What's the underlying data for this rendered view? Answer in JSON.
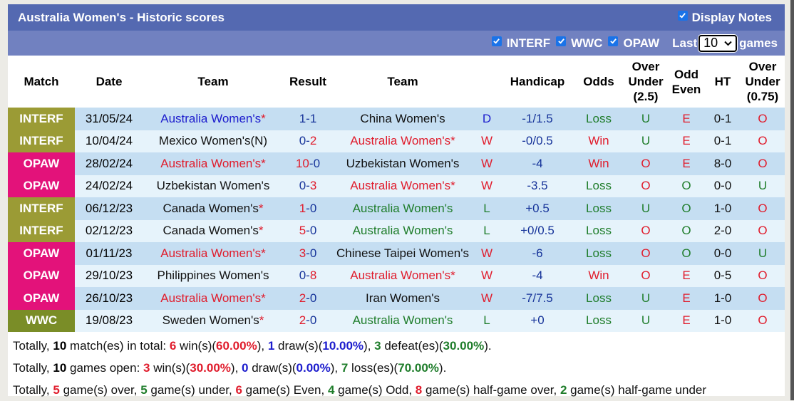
{
  "header": {
    "title": "Australia Women's - Historic scores",
    "display_notes_label": "Display Notes",
    "display_notes_checked": true
  },
  "filters": {
    "items": [
      {
        "label": "INTERF",
        "checked": true
      },
      {
        "label": "WWC",
        "checked": true
      },
      {
        "label": "OPAW",
        "checked": true
      }
    ],
    "last_label": "Last",
    "games_count": "10",
    "games_label": "games"
  },
  "columns": {
    "match": "Match",
    "date": "Date",
    "home_team": "Team",
    "result": "Result",
    "away_team": "Team",
    "handicap": "Handicap",
    "odds": "Odds",
    "over_under_line1": "Over",
    "over_under_line2": "Under",
    "over_under_line3": "(2.5)",
    "odd_even_line1": "Odd",
    "odd_even_line2": "Even",
    "ht": "HT",
    "ht_over_under_line1": "Over",
    "ht_over_under_line2": "Under",
    "ht_over_under_line3": "(0.75)"
  },
  "colors": {
    "INTERF": "#9b9b35",
    "WWC": "#7a8d27",
    "OPAW": "#e3127a",
    "header_bar": "#5469b1",
    "filter_bar": "#7181c0"
  },
  "rows": [
    {
      "league": "INTERF",
      "date": "31/05/24",
      "home": "Australia Women's",
      "home_star": "*",
      "home_color": "blue",
      "score_home": "1",
      "score_away": "1",
      "score_home_color": "navy",
      "score_away_color": "navy",
      "away": "China Women's",
      "away_star": "",
      "away_color": "dark",
      "outcome": "D",
      "outcome_color": "blue",
      "handicap": "-1/1.5",
      "odds": "Loss",
      "odds_color": "green",
      "ou": "U",
      "ou_color": "green",
      "oe": "E",
      "oe_color": "red",
      "ht": "0-1",
      "htou": "O",
      "htou_color": "red"
    },
    {
      "league": "INTERF",
      "date": "10/04/24",
      "home": "Mexico Women's(N)",
      "home_star": "",
      "home_color": "dark",
      "score_home": "0",
      "score_away": "2",
      "score_home_color": "navy",
      "score_away_color": "red",
      "away": "Australia Women's",
      "away_star": "*",
      "away_color": "red",
      "outcome": "W",
      "outcome_color": "red",
      "handicap": "-0/0.5",
      "odds": "Win",
      "odds_color": "red",
      "ou": "U",
      "ou_color": "green",
      "oe": "E",
      "oe_color": "red",
      "ht": "0-1",
      "htou": "O",
      "htou_color": "red"
    },
    {
      "league": "OPAW",
      "date": "28/02/24",
      "home": "Australia Women's",
      "home_star": "*",
      "home_color": "red",
      "score_home": "10",
      "score_away": "0",
      "score_home_color": "red",
      "score_away_color": "navy",
      "away": "Uzbekistan Women's",
      "away_star": "",
      "away_color": "dark",
      "outcome": "W",
      "outcome_color": "red",
      "handicap": "-4",
      "odds": "Win",
      "odds_color": "red",
      "ou": "O",
      "ou_color": "red",
      "oe": "E",
      "oe_color": "red",
      "ht": "8-0",
      "htou": "O",
      "htou_color": "red"
    },
    {
      "league": "OPAW",
      "date": "24/02/24",
      "home": "Uzbekistan Women's",
      "home_star": "",
      "home_color": "dark",
      "score_home": "0",
      "score_away": "3",
      "score_home_color": "navy",
      "score_away_color": "red",
      "away": "Australia Women's",
      "away_star": "*",
      "away_color": "red",
      "outcome": "W",
      "outcome_color": "red",
      "handicap": "-3.5",
      "odds": "Loss",
      "odds_color": "green",
      "ou": "O",
      "ou_color": "red",
      "oe": "O",
      "oe_color": "green",
      "ht": "0-0",
      "htou": "U",
      "htou_color": "green"
    },
    {
      "league": "INTERF",
      "date": "06/12/23",
      "home": "Canada Women's",
      "home_star": "*",
      "home_color": "dark",
      "score_home": "1",
      "score_away": "0",
      "score_home_color": "red",
      "score_away_color": "navy",
      "away": "Australia Women's",
      "away_star": "",
      "away_color": "green",
      "outcome": "L",
      "outcome_color": "green",
      "handicap": "+0.5",
      "odds": "Loss",
      "odds_color": "green",
      "ou": "U",
      "ou_color": "green",
      "oe": "O",
      "oe_color": "green",
      "ht": "1-0",
      "htou": "O",
      "htou_color": "red"
    },
    {
      "league": "INTERF",
      "date": "02/12/23",
      "home": "Canada Women's",
      "home_star": "*",
      "home_color": "dark",
      "score_home": "5",
      "score_away": "0",
      "score_home_color": "red",
      "score_away_color": "navy",
      "away": "Australia Women's",
      "away_star": "",
      "away_color": "green",
      "outcome": "L",
      "outcome_color": "green",
      "handicap": "+0/0.5",
      "odds": "Loss",
      "odds_color": "green",
      "ou": "O",
      "ou_color": "red",
      "oe": "O",
      "oe_color": "green",
      "ht": "2-0",
      "htou": "O",
      "htou_color": "red"
    },
    {
      "league": "OPAW",
      "date": "01/11/23",
      "home": "Australia Women's",
      "home_star": "*",
      "home_color": "red",
      "score_home": "3",
      "score_away": "0",
      "score_home_color": "red",
      "score_away_color": "navy",
      "away": "Chinese Taipei Women's",
      "away_star": "",
      "away_color": "dark",
      "outcome": "W",
      "outcome_color": "red",
      "handicap": "-6",
      "odds": "Loss",
      "odds_color": "green",
      "ou": "O",
      "ou_color": "red",
      "oe": "O",
      "oe_color": "green",
      "ht": "0-0",
      "htou": "U",
      "htou_color": "green"
    },
    {
      "league": "OPAW",
      "date": "29/10/23",
      "home": "Philippines Women's",
      "home_star": "",
      "home_color": "dark",
      "score_home": "0",
      "score_away": "8",
      "score_home_color": "navy",
      "score_away_color": "red",
      "away": "Australia Women's",
      "away_star": "*",
      "away_color": "red",
      "outcome": "W",
      "outcome_color": "red",
      "handicap": "-4",
      "odds": "Win",
      "odds_color": "red",
      "ou": "O",
      "ou_color": "red",
      "oe": "E",
      "oe_color": "red",
      "ht": "0-5",
      "htou": "O",
      "htou_color": "red"
    },
    {
      "league": "OPAW",
      "date": "26/10/23",
      "home": "Australia Women's",
      "home_star": "*",
      "home_color": "red",
      "score_home": "2",
      "score_away": "0",
      "score_home_color": "red",
      "score_away_color": "navy",
      "away": "Iran Women's",
      "away_star": "",
      "away_color": "dark",
      "outcome": "W",
      "outcome_color": "red",
      "handicap": "-7/7.5",
      "odds": "Loss",
      "odds_color": "green",
      "ou": "U",
      "ou_color": "green",
      "oe": "E",
      "oe_color": "red",
      "ht": "1-0",
      "htou": "O",
      "htou_color": "red"
    },
    {
      "league": "WWC",
      "date": "19/08/23",
      "home": "Sweden Women's",
      "home_star": "*",
      "home_color": "dark",
      "score_home": "2",
      "score_away": "0",
      "score_home_color": "red",
      "score_away_color": "navy",
      "away": "Australia Women's",
      "away_star": "",
      "away_color": "green",
      "outcome": "L",
      "outcome_color": "green",
      "handicap": "+0",
      "odds": "Loss",
      "odds_color": "green",
      "ou": "U",
      "ou_color": "green",
      "oe": "E",
      "oe_color": "red",
      "ht": "1-0",
      "htou": "O",
      "htou_color": "red"
    }
  ],
  "summary": {
    "line1": [
      {
        "t": "Totally, "
      },
      {
        "t": "10",
        "c": "black"
      },
      {
        "t": " match(es) in total: "
      },
      {
        "t": "6",
        "c": "red"
      },
      {
        "t": " win(s)("
      },
      {
        "t": "60.00%",
        "c": "red"
      },
      {
        "t": "), "
      },
      {
        "t": "1",
        "c": "blue"
      },
      {
        "t": " draw(s)("
      },
      {
        "t": "10.00%",
        "c": "blue"
      },
      {
        "t": "), "
      },
      {
        "t": "3",
        "c": "green"
      },
      {
        "t": " defeat(es)("
      },
      {
        "t": "30.00%",
        "c": "green"
      },
      {
        "t": ")."
      }
    ],
    "line2": [
      {
        "t": "Totally, "
      },
      {
        "t": "10",
        "c": "black"
      },
      {
        "t": " games open: "
      },
      {
        "t": "3",
        "c": "red"
      },
      {
        "t": " win(s)("
      },
      {
        "t": "30.00%",
        "c": "red"
      },
      {
        "t": "), "
      },
      {
        "t": "0",
        "c": "blue"
      },
      {
        "t": " draw(s)("
      },
      {
        "t": "0.00%",
        "c": "blue"
      },
      {
        "t": "), "
      },
      {
        "t": "7",
        "c": "green"
      },
      {
        "t": " loss(es)("
      },
      {
        "t": "70.00%",
        "c": "green"
      },
      {
        "t": ")."
      }
    ],
    "line3": [
      {
        "t": "Totally, "
      },
      {
        "t": "5",
        "c": "red"
      },
      {
        "t": " game(s) over, "
      },
      {
        "t": "5",
        "c": "green"
      },
      {
        "t": " game(s) under, "
      },
      {
        "t": "6",
        "c": "red"
      },
      {
        "t": " game(s) Even, "
      },
      {
        "t": "4",
        "c": "green"
      },
      {
        "t": " game(s) Odd, "
      },
      {
        "t": "8",
        "c": "red"
      },
      {
        "t": " game(s) half-game over, "
      },
      {
        "t": "2",
        "c": "green"
      },
      {
        "t": " game(s) half-game under"
      }
    ]
  }
}
